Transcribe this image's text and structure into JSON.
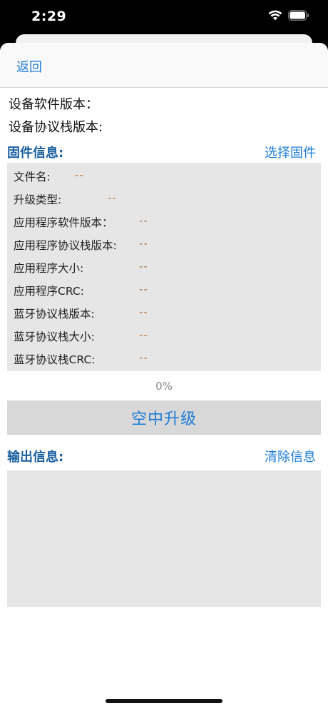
{
  "status_bar": {
    "time": "2:29",
    "icons": [
      "wifi-icon",
      "battery-icon"
    ]
  },
  "nav": {
    "back_label": "返回"
  },
  "device": {
    "software_version_label": "设备软件版本：",
    "stack_version_label": "设备协议栈版本:"
  },
  "firmware": {
    "title": "固件信息:",
    "select_label": "选择固件",
    "rows": [
      {
        "label": "文件名:",
        "value": "--"
      },
      {
        "label": "升级类型:",
        "value": "--"
      },
      {
        "label": "应用程序软件版本：",
        "value": "--"
      },
      {
        "label": "应用程序协议栈版本:",
        "value": "--"
      },
      {
        "label": "应用程序大小:",
        "value": "--"
      },
      {
        "label": "应用程序CRC:",
        "value": "--"
      },
      {
        "label": "蓝牙协议栈版本:",
        "value": "--"
      },
      {
        "label": "蓝牙协议栈大小:",
        "value": "--"
      },
      {
        "label": "蓝牙协议栈CRC:",
        "value": "--"
      }
    ]
  },
  "progress": {
    "percent_text": "0%"
  },
  "ota_button_label": "空中升级",
  "output": {
    "title": "输出信息:",
    "clear_label": "清除信息",
    "content": ""
  },
  "colors": {
    "accent": "#1d7cd6",
    "section_title": "#1a5fa0",
    "value_text": "#b07a4b",
    "panel_bg": "#e6e6e6"
  }
}
